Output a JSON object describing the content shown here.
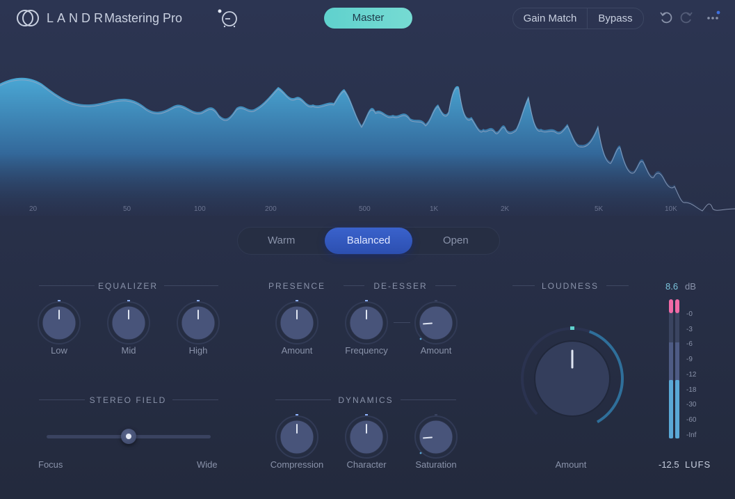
{
  "header": {
    "brand": "LANDR",
    "product": "Mastering Pro",
    "reference_icon": "reference-track-icon",
    "master_label": "Master",
    "gain_match_label": "Gain Match",
    "bypass_label": "Bypass",
    "undo_icon": "undo-icon",
    "redo_icon": "redo-icon",
    "more_icon": "more-options-icon",
    "accent_color": "#66d5cf",
    "notification_color": "#3d6fe0"
  },
  "spectrum": {
    "freq_labels": [
      "20",
      "50",
      "100",
      "200",
      "500",
      "1K",
      "2K",
      "5K",
      "10K"
    ],
    "fill_color": "#3f8fbf"
  },
  "tonal_style": {
    "options": [
      "Warm",
      "Balanced",
      "Open"
    ],
    "selected": "Balanced",
    "active_color": "#3259c0"
  },
  "equalizer": {
    "title": "EQUALIZER",
    "knobs": [
      {
        "label": "Low",
        "value": 0.5
      },
      {
        "label": "Mid",
        "value": 0.5
      },
      {
        "label": "High",
        "value": 0.5
      }
    ]
  },
  "presence": {
    "title": "PRESENCE",
    "knob": {
      "label": "Amount",
      "value": 0.5
    }
  },
  "de_esser": {
    "title": "DE-ESSER",
    "knobs": [
      {
        "label": "Frequency",
        "value": 0.5
      },
      {
        "label": "Amount",
        "value": 0.15
      }
    ]
  },
  "loudness": {
    "title": "LOUDNESS",
    "knob": {
      "label": "Amount",
      "value": 0.5
    },
    "arc_color": "#2f6f9a"
  },
  "stereo_field": {
    "title": "STEREO FIELD",
    "min_label": "Focus",
    "max_label": "Wide",
    "value": 0.5
  },
  "dynamics": {
    "title": "DYNAMICS",
    "knobs": [
      {
        "label": "Compression",
        "value": 0.5
      },
      {
        "label": "Character",
        "value": 0.5
      },
      {
        "label": "Saturation",
        "value": 0.15
      }
    ]
  },
  "meter": {
    "peak_value": "8.6",
    "peak_unit": "dB",
    "scale": [
      "-0",
      "-3",
      "-6",
      "-9",
      "-12",
      "-18",
      "-30",
      "-60",
      "-Inf"
    ],
    "lufs_value": "-12.5",
    "lufs_unit": "LUFS",
    "level_fraction": 0.42,
    "clip_color": "#f06aa6",
    "level_color": "#5aa8d6"
  }
}
